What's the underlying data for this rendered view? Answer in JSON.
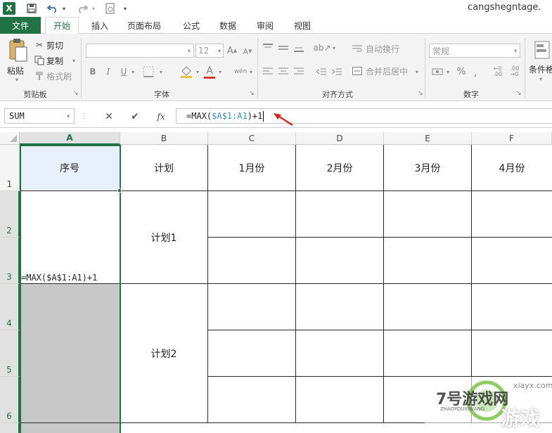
{
  "title": "cangshegntage.",
  "app_logo": "X",
  "tabs": {
    "file": "文件",
    "home": "开始",
    "insert": "插入",
    "layout": "页面布局",
    "formulas": "公式",
    "data": "数据",
    "review": "审阅",
    "view": "视图"
  },
  "ribbon": {
    "clipboard": {
      "paste": "粘贴",
      "cut": "剪切",
      "copy": "复制",
      "format_painter": "格式刷",
      "group": "剪贴板"
    },
    "font": {
      "size": "12",
      "group": "字体",
      "bold": "B",
      "italic": "I",
      "underline": "U",
      "font_color": "A",
      "phonetic": "wén"
    },
    "alignment": {
      "wrap": "自动换行",
      "merge": "合并后居中",
      "group": "对齐方式"
    },
    "number": {
      "format": "常规",
      "percent": "%",
      "group": "数字"
    },
    "styles": {
      "conditional": "条件格"
    }
  },
  "formula_bar": {
    "name_box": "SUM",
    "fx": "fx",
    "formula_prefix": "=MAX(",
    "formula_ref": "$A$1:A1",
    "formula_suffix": ")+1"
  },
  "grid": {
    "columns": [
      "A",
      "B",
      "C",
      "D",
      "E",
      "F"
    ],
    "rows": [
      "1",
      "2",
      "3",
      "4",
      "5",
      "6"
    ],
    "header": [
      "序号",
      "计划",
      "1月份",
      "2月份",
      "3月份",
      "4月份"
    ],
    "plans": [
      "计划1",
      "计划2"
    ],
    "edit_text": "=MAX($A$1:A1)+1"
  },
  "watermark": {
    "brand": "7号游戏网",
    "sub": "ZHAOYOUXIWANG",
    "tail": "游戏",
    "site": "xiayx.com"
  },
  "colors": {
    "accent": "#217346",
    "selection_fill": "#e8f0fb",
    "gray_fill": "#c8c8c8",
    "arrow": "#d0281f"
  }
}
